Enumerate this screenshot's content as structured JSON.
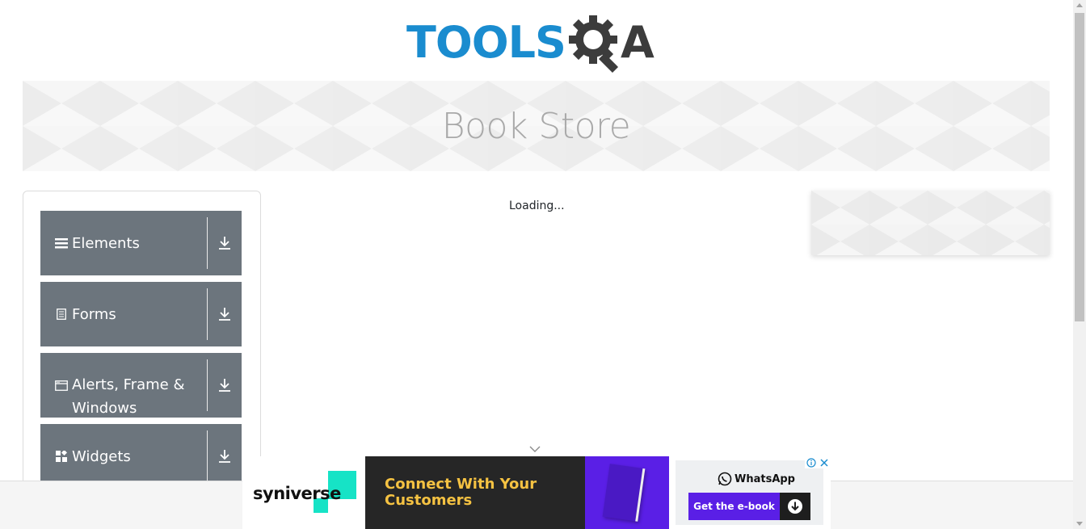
{
  "logo": {
    "text_left": "TOOLS",
    "text_right": "A",
    "icon": "gear-magnifier-icon",
    "colors": {
      "blue": "#1a8ccf",
      "dark": "#3c3c3c"
    }
  },
  "banner": {
    "title": "Book Store"
  },
  "sidebar": {
    "groups": [
      {
        "label": "Elements",
        "icon": "hamburger-icon",
        "arrow": "download-icon"
      },
      {
        "label": "Forms",
        "icon": "document-icon",
        "arrow": "download-icon"
      },
      {
        "label": "Alerts, Frame &",
        "label2": "Windows",
        "icon": "window-icon",
        "arrow": "download-icon"
      },
      {
        "label": "Widgets",
        "icon": "widgets-icon",
        "arrow": "download-icon"
      }
    ],
    "header_color": "#6c757d"
  },
  "main": {
    "loading_text": "Loading..."
  },
  "ad": {
    "brand": "syniverse",
    "brand_dot": ".",
    "headline_line1": "Connect With Your",
    "headline_line2": "Customers",
    "whatsapp_label": "WhatsApp",
    "cta_label": "Get the e-book",
    "colors": {
      "purple": "#5a1fe6",
      "teal": "#16e3c6",
      "yellow": "#f5c242"
    }
  }
}
